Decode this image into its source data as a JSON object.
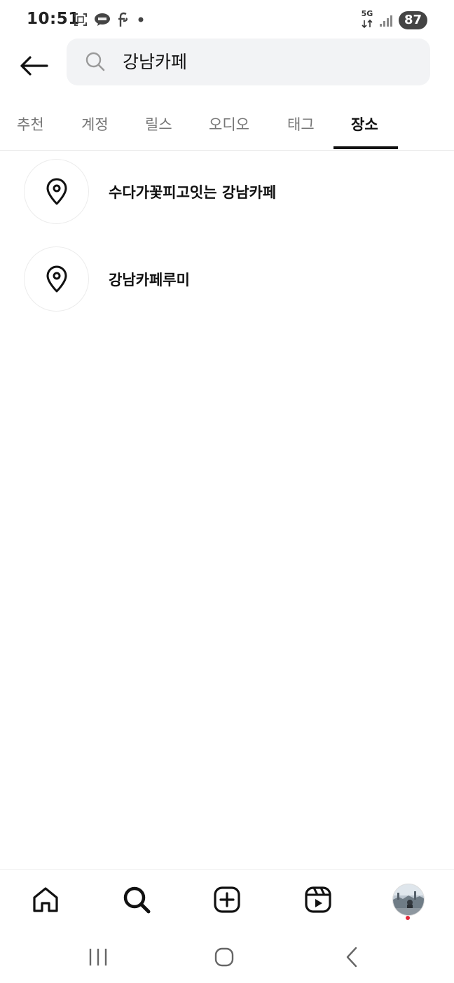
{
  "status_bar": {
    "time": "10:51",
    "network_label": "5G",
    "battery": "87"
  },
  "header": {
    "back_icon": "arrow-left-icon",
    "search_value": "강남카페",
    "search_icon": "search-icon"
  },
  "tabs": [
    {
      "label": "추천",
      "active": false
    },
    {
      "label": "계정",
      "active": false
    },
    {
      "label": "릴스",
      "active": false
    },
    {
      "label": "오디오",
      "active": false
    },
    {
      "label": "태그",
      "active": false
    },
    {
      "label": "장소",
      "active": true
    }
  ],
  "results": [
    {
      "icon": "location-pin-icon",
      "label": "수다가꽃피고잇는 강남카페"
    },
    {
      "icon": "location-pin-icon",
      "label": "강남카페루미"
    }
  ],
  "bottom_nav": {
    "items": [
      "home-icon",
      "search-icon",
      "add-post-icon",
      "reels-icon",
      "profile-avatar"
    ]
  },
  "system_nav": {
    "items": [
      "recent-apps-icon",
      "home-circle-icon",
      "back-chevron-icon"
    ]
  }
}
